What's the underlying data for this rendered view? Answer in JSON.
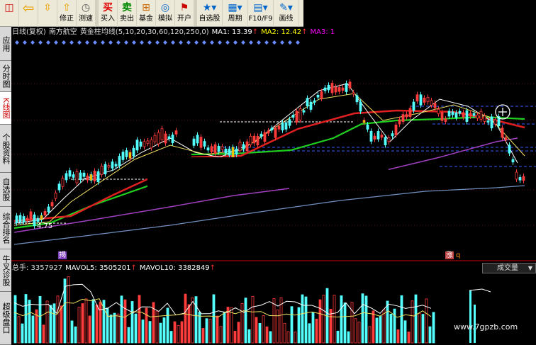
{
  "toolbar": {
    "buttons": [
      {
        "label": "",
        "icon": "window-icon"
      },
      {
        "label": "",
        "icon": "back-arrow-icon"
      },
      {
        "label": "",
        "icon": "up-down-arrow-icon"
      },
      {
        "label": "修正",
        "icon": "up-arrow-icon"
      },
      {
        "label": "测速",
        "icon": "clock-icon"
      },
      {
        "label": "买入",
        "icon": "buy-icon"
      },
      {
        "label": "卖出",
        "icon": "sell-icon"
      },
      {
        "label": "基金",
        "icon": "fund-icon"
      },
      {
        "label": "模拟",
        "icon": "simulate-icon"
      },
      {
        "label": "开户",
        "icon": "account-icon"
      },
      {
        "label": "自选股",
        "icon": "star-icon"
      },
      {
        "label": "周期",
        "icon": "calendar-icon"
      },
      {
        "label": "F10/F9",
        "icon": "document-icon"
      },
      {
        "label": "画线",
        "icon": "pen-icon"
      }
    ]
  },
  "sidetabs": [
    "应用",
    "分时图",
    "K线图",
    "个股资料",
    "自选股",
    "综合排名",
    "牛叉诊股",
    "超级盘口"
  ],
  "header": {
    "period": "日线(复权)",
    "stock_name": "南方航空",
    "indicator": "黄金柱均线(5,10,20,30,60,120,250,0)",
    "ma1": "MA1: 13.39",
    "ma2": "MA2: 12.42",
    "ma3": "MA3: 1"
  },
  "chart": {
    "low_label": "4.75",
    "mark_left": "揭",
    "mark_right": "涨",
    "mark_right_q": "q"
  },
  "volume": {
    "total": "总手: 3357927",
    "mavol5": "MAVOL5: 3505201",
    "mavol10": "MAVOL10: 3382849",
    "dropdown": "成交量"
  },
  "watermark": "www.7gpzb.com",
  "colors": {
    "up": "#ff3c3c",
    "down": "#54ffff",
    "ma_red": "#e02020",
    "ma_green": "#20d020",
    "ma_purple": "#a040c0",
    "ma_blue": "#7090c0",
    "gold": "#f0c000"
  }
}
